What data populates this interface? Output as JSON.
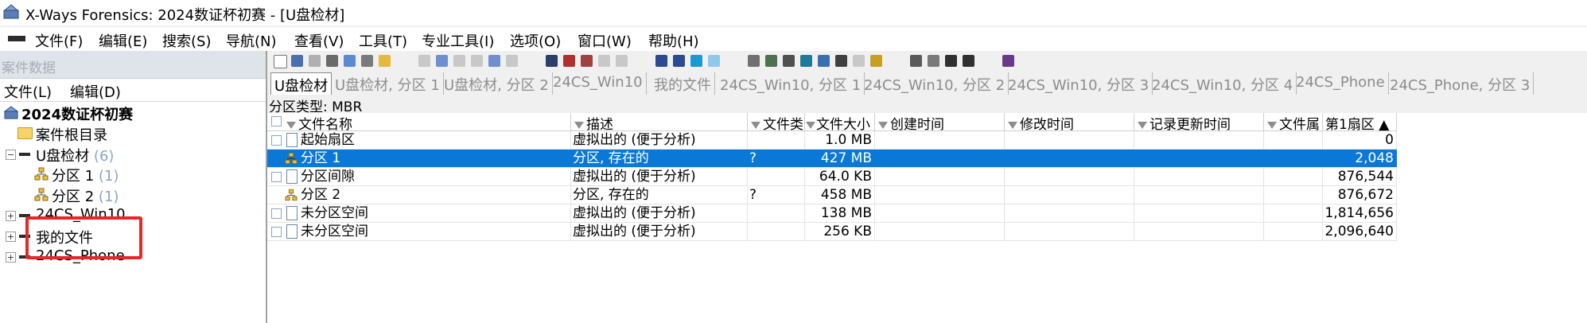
{
  "window": {
    "title": "X-Ways Forensics: 2024数证杯初赛 - [U盘检材]"
  },
  "menu": [
    "文件(F)",
    "编辑(E)",
    "搜索(S)",
    "导航(N)",
    "查看(V)",
    "工具(T)",
    "专业工具(I)",
    "选项(O)",
    "窗口(W)",
    "帮助(H)"
  ],
  "case_panel": {
    "title": "案件数据",
    "menu": [
      "文件(L)",
      "编辑(D)"
    ],
    "tree": {
      "root": "2024数证杯初赛",
      "case_root_dir": "案件根目录",
      "usb": {
        "label": "U盘检材",
        "count": "(6)"
      },
      "partitions": [
        {
          "label": "分区 1",
          "count": "(1)"
        },
        {
          "label": "分区 2",
          "count": "(1)"
        }
      ],
      "others": [
        "24CS_Win10",
        "我的文件",
        "24CS_Phone"
      ]
    }
  },
  "tabs": [
    "U盘检材",
    "U盘检材, 分区 1",
    "U盘检材, 分区 2",
    "24CS_Win10",
    "我的文件",
    "24CS_Win10, 分区 1",
    "24CS_Win10, 分区 2",
    "24CS_Win10, 分区 3",
    "24CS_Win10, 分区 4",
    "24CS_Phone",
    "24CS_Phone, 分区 3"
  ],
  "partition_type": "分区类型: MBR",
  "table": {
    "columns": [
      "文件名称",
      "描述",
      "文件类",
      "文件大小",
      "创建时间",
      "修改时间",
      "记录更新时间",
      "文件属",
      "第1扇区 ▲"
    ],
    "rows": [
      {
        "name": "起始扇区",
        "desc": "虚拟出的 (便于分析)",
        "type": "",
        "size": "1.0 MB",
        "sector": "0"
      },
      {
        "name": "分区 1",
        "desc": "分区, 存在的",
        "type": "?",
        "size": "427 MB",
        "sector": "2,048",
        "selected": true
      },
      {
        "name": "分区间隙",
        "desc": "虚拟出的 (便于分析)",
        "type": "",
        "size": "64.0 KB",
        "sector": "876,544"
      },
      {
        "name": "分区 2",
        "desc": "分区, 存在的",
        "type": "?",
        "size": "458 MB",
        "sector": "876,672"
      },
      {
        "name": "未分区空间",
        "desc": "虚拟出的 (便于分析)",
        "type": "",
        "size": "138 MB",
        "sector": "1,814,656"
      },
      {
        "name": "未分区空间",
        "desc": "虚拟出的 (便于分析)",
        "type": "",
        "size": "256 KB",
        "sector": "2,096,640"
      }
    ]
  },
  "colors": {
    "selection": "#0a78d7",
    "highlight_box": "#e8262a"
  }
}
